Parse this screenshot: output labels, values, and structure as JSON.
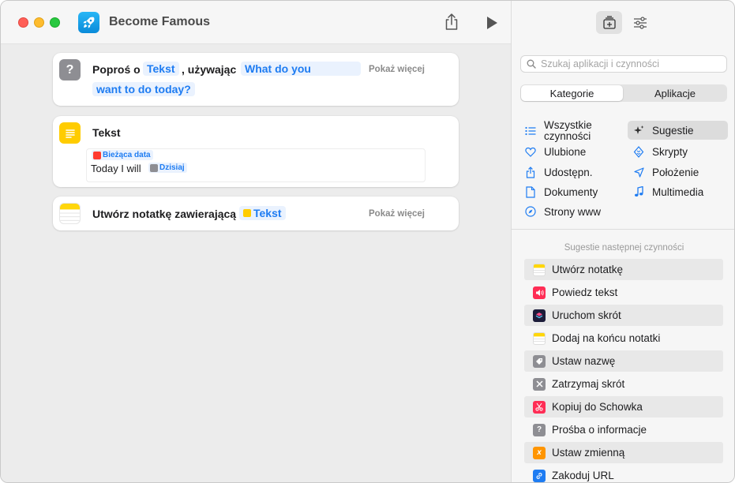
{
  "window": {
    "title": "Become Famous"
  },
  "workflow": {
    "ask": {
      "prefix": "Poproś o",
      "token_type": "Tekst",
      "middle": ", używając",
      "prompt_line1": "What do you",
      "prompt_line2": "want to do today?",
      "show_more": "Pokaż więcej"
    },
    "text": {
      "title": "Tekst",
      "date_token": "Bieżąca data",
      "body_text": "Today I will",
      "today_token": "Dzisiaj"
    },
    "note": {
      "prefix": "Utwórz notatkę zawierającą",
      "token": "Tekst",
      "show_more": "Pokaż więcej"
    }
  },
  "sidebar": {
    "search_placeholder": "Szukaj aplikacji i czynności",
    "tabs": [
      "Kategorie",
      "Aplikacje"
    ],
    "categories_left": [
      {
        "label": "Wszystkie czynności",
        "icon": "list-icon"
      },
      {
        "label": "Ulubione",
        "icon": "heart-icon"
      },
      {
        "label": "Udostępn.",
        "icon": "share-icon"
      },
      {
        "label": "Dokumenty",
        "icon": "document-icon"
      },
      {
        "label": "Strony www",
        "icon": "compass-icon"
      }
    ],
    "categories_right": [
      {
        "label": "Sugestie",
        "icon": "sparkles-icon",
        "selected": true
      },
      {
        "label": "Skrypty",
        "icon": "script-icon"
      },
      {
        "label": "Położenie",
        "icon": "location-icon"
      },
      {
        "label": "Multimedia",
        "icon": "music-icon"
      }
    ],
    "suggestions_header": "Sugestie następnej czynności",
    "suggestions": [
      {
        "label": "Utwórz notatkę",
        "icon": "notes-icon",
        "color": "#f5f5f5"
      },
      {
        "label": "Powiedz tekst",
        "icon": "speaker-icon",
        "color": "#ff2d55"
      },
      {
        "label": "Uruchom skrót",
        "icon": "shortcuts-icon",
        "color": "#1c1c3a"
      },
      {
        "label": "Dodaj na końcu notatki",
        "icon": "notes-icon",
        "color": "#f5f5f5"
      },
      {
        "label": "Ustaw nazwę",
        "icon": "tag-icon",
        "color": "#8e8e93"
      },
      {
        "label": "Zatrzymaj skrót",
        "icon": "stop-icon",
        "color": "#8e8e93"
      },
      {
        "label": "Kopiuj do Schowka",
        "icon": "scissors-icon",
        "color": "#ff2d55"
      },
      {
        "label": "Prośba o informacje",
        "icon": "question-icon",
        "color": "#8e8e93"
      },
      {
        "label": "Ustaw zmienną",
        "icon": "variable-icon",
        "color": "#ff9500"
      },
      {
        "label": "Zakoduj URL",
        "icon": "link-icon",
        "color": "#1e7cf2"
      }
    ]
  }
}
